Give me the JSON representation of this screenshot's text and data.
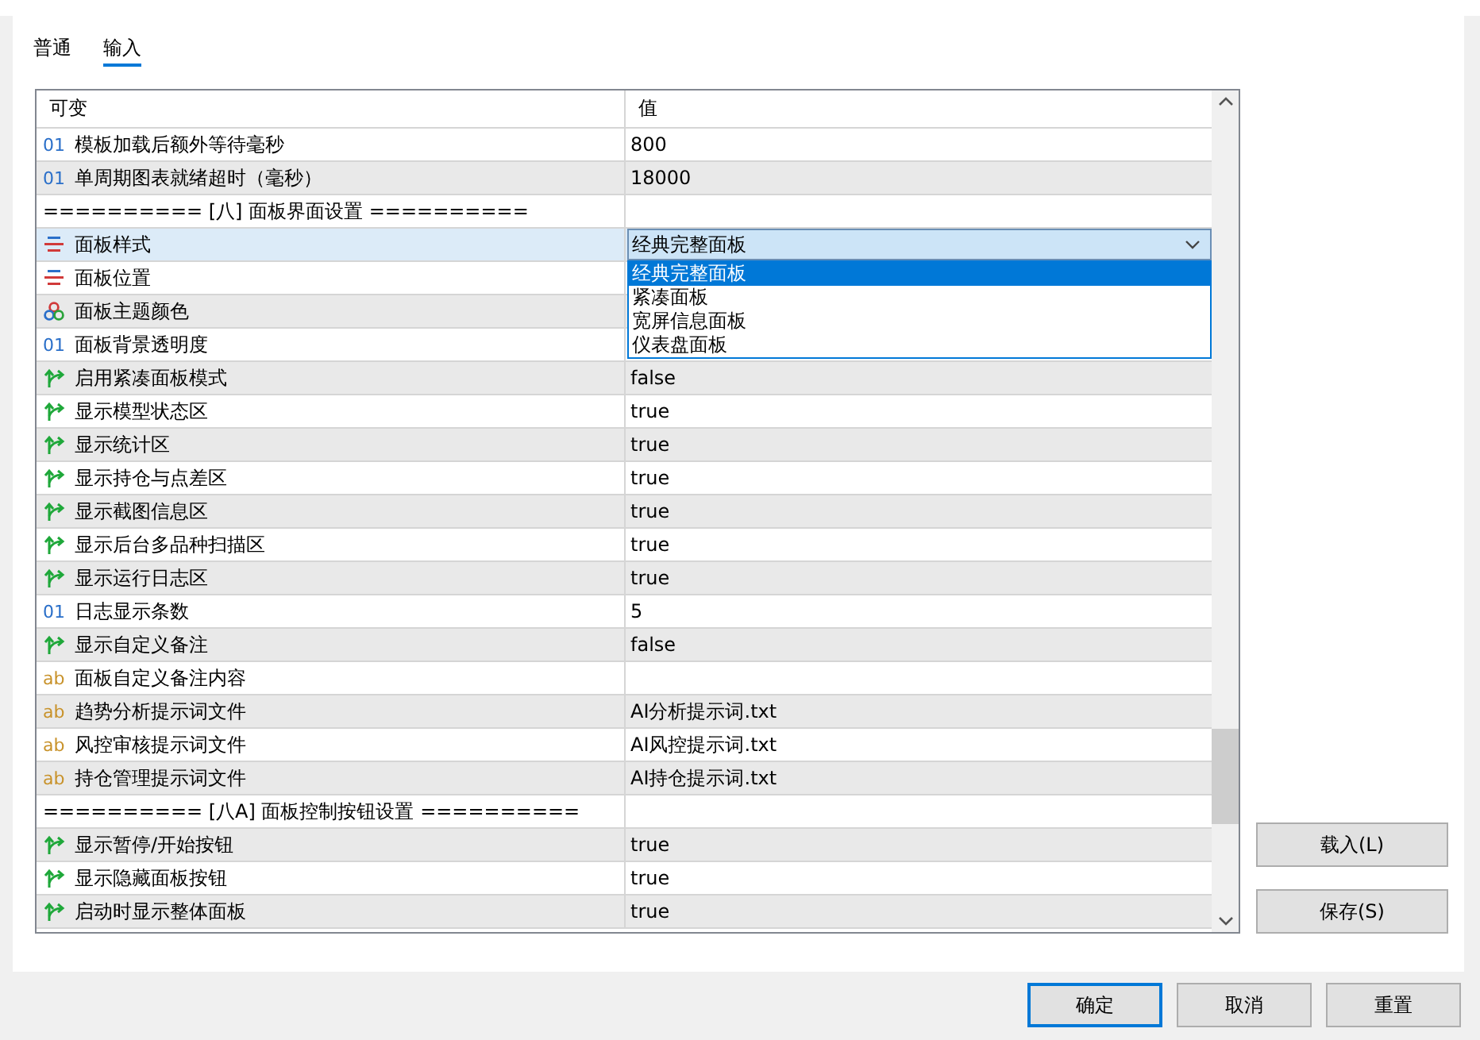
{
  "tabs": [
    {
      "label": "普通",
      "selected": false
    },
    {
      "label": "输入",
      "selected": true
    }
  ],
  "table": {
    "columns": [
      "可变",
      "值"
    ],
    "rows": [
      {
        "kind": "int",
        "icon": "01",
        "name": "模板加载后额外等待毫秒",
        "value": "800",
        "selected": false
      },
      {
        "kind": "int",
        "icon": "01",
        "name": "单周期图表就绪超时（毫秒）",
        "value": "18000",
        "selected": false
      },
      {
        "kind": "separator",
        "name": "========== [八] 面板界面设置 ==========",
        "selected": false
      },
      {
        "kind": "enum",
        "name": "面板样式",
        "value": "经典完整面板",
        "selected": true,
        "expanded": true,
        "options": [
          {
            "label": "经典完整面板",
            "selected": true
          },
          {
            "label": "紧凑面板",
            "selected": false
          },
          {
            "label": "宽屏信息面板",
            "selected": false
          },
          {
            "label": "仪表盘面板",
            "selected": false
          }
        ]
      },
      {
        "kind": "enum",
        "name": "面板位置",
        "selected": false
      },
      {
        "kind": "color",
        "name": "面板主题颜色",
        "selected": false
      },
      {
        "kind": "int",
        "icon": "01",
        "name": "面板背景透明度",
        "selected": false
      },
      {
        "kind": "bool",
        "name": "启用紧凑面板模式",
        "value": "false",
        "selected": false
      },
      {
        "kind": "bool",
        "name": "显示模型状态区",
        "value": "true",
        "selected": false
      },
      {
        "kind": "bool",
        "name": "显示统计区",
        "value": "true",
        "selected": false
      },
      {
        "kind": "bool",
        "name": "显示持仓与点差区",
        "value": "true",
        "selected": false
      },
      {
        "kind": "bool",
        "name": "显示截图信息区",
        "value": "true",
        "selected": false
      },
      {
        "kind": "bool",
        "name": "显示后台多品种扫描区",
        "value": "true",
        "selected": false
      },
      {
        "kind": "bool",
        "name": "显示运行日志区",
        "value": "true",
        "selected": false
      },
      {
        "kind": "int",
        "icon": "01",
        "name": "日志显示条数",
        "value": "5",
        "selected": false
      },
      {
        "kind": "bool",
        "name": "显示自定义备注",
        "value": "false",
        "selected": false
      },
      {
        "kind": "string",
        "icon": "ab",
        "name": "面板自定义备注内容",
        "selected": false
      },
      {
        "kind": "string",
        "icon": "ab",
        "name": "趋势分析提示词文件",
        "value": "AI分析提示词.txt",
        "selected": false
      },
      {
        "kind": "string",
        "icon": "ab",
        "name": "风控审核提示词文件",
        "value": "AI风控提示词.txt",
        "selected": false
      },
      {
        "kind": "string",
        "icon": "ab",
        "name": "持仓管理提示词文件",
        "value": "AI持仓提示词.txt",
        "selected": false
      },
      {
        "kind": "separator",
        "name": "========== [八A] 面板控制按钮设置 ==========",
        "selected": false
      },
      {
        "kind": "bool",
        "name": "显示暂停/开始按钮",
        "value": "true",
        "selected": false
      },
      {
        "kind": "bool",
        "name": "显示隐藏面板按钮",
        "value": "true",
        "selected": false
      },
      {
        "kind": "bool",
        "name": "启动时显示整体面板",
        "value": "true",
        "selected": false
      }
    ]
  },
  "side_buttons": [
    "载入(L)",
    "保存(S)"
  ],
  "dialog_buttons": [
    {
      "label": "确定",
      "default": true
    },
    {
      "label": "取消",
      "default": false
    },
    {
      "label": "重置",
      "default": false
    }
  ]
}
